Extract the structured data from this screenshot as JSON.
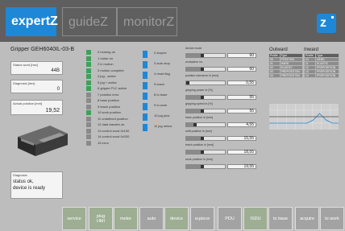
{
  "header": {
    "tabs": [
      {
        "label": "expertZ",
        "active": true
      },
      {
        "label": "guideZ",
        "active": false
      },
      {
        "label": "monitorZ",
        "active": false
      }
    ],
    "brand_glyph": "z",
    "accent_color": "#1e88d6"
  },
  "gripper": {
    "title": "Gripper GEH6040IL-03-B",
    "status_word": {
      "label": "Status word [hex]",
      "value": "44B"
    },
    "diagnosis": {
      "label": "Diagnosis [hex]",
      "value": "0"
    },
    "actual_position": {
      "label": "Actual position [mm]",
      "value": "19,52"
    },
    "diagnosis_panel": {
      "label": "Diagnosis",
      "text": "status ok,\ndevice is ready"
    }
  },
  "inputs": [
    {
      "num": "0",
      "label": "homing ok",
      "state": "green"
    },
    {
      "num": "1",
      "label": "motor on",
      "state": "green"
    },
    {
      "num": "2",
      "label": "in motion",
      "state": "green"
    },
    {
      "num": "3",
      "label": "motion complete",
      "state": "green"
    },
    {
      "num": "4",
      "label": "jog - active",
      "state": "green"
    },
    {
      "num": "5",
      "label": "jog + active",
      "state": "green"
    },
    {
      "num": "6",
      "label": "gripper PLC active",
      "state": "green"
    },
    {
      "num": "7",
      "label": "position error",
      "state": "gray"
    },
    {
      "num": "8",
      "label": "base position",
      "state": "gray"
    },
    {
      "num": "9",
      "label": "teach position",
      "state": "gray"
    },
    {
      "num": "10",
      "label": "work position",
      "state": "green"
    },
    {
      "num": "11",
      "label": "undefined position",
      "state": "gray"
    },
    {
      "num": "12",
      "label": "data transfer ok",
      "state": "gray"
    },
    {
      "num": "13",
      "label": "control word 0x100",
      "state": "gray"
    },
    {
      "num": "14",
      "label": "control word 0x200",
      "state": "gray"
    },
    {
      "num": "15",
      "label": "error",
      "state": "gray"
    }
  ],
  "outputs": [
    {
      "num": "0",
      "label": "stop/re"
    },
    {
      "num": "3",
      "label": "auto stop"
    },
    {
      "num": "4",
      "label": "reset flag"
    },
    {
      "num": "5",
      "label": "teach"
    },
    {
      "num": "8",
      "label": "to base"
    },
    {
      "num": "9",
      "label": "to work"
    },
    {
      "num": "10",
      "label": "jog plus"
    },
    {
      "num": "11",
      "label": "jog minus"
    }
  ],
  "params": [
    {
      "label": "device mode",
      "value": "60",
      "fill": 0.42
    },
    {
      "label": "workpiece no.",
      "value": "60",
      "fill": 0.42
    },
    {
      "label": "position tolerance in [mm]",
      "value": "0,55",
      "fill": 0.05
    },
    {
      "label": "gripping power in [%]",
      "value": "55",
      "fill": 0.42
    },
    {
      "label": "gripping speed in [%]",
      "value": "55",
      "fill": 0.42
    },
    {
      "label": "base position in [mm]",
      "value": "4,55",
      "fill": 0.22
    },
    {
      "label": "shift position in [mm]",
      "value": "15,55",
      "fill": 0.42
    },
    {
      "label": "teach position in [mm]",
      "value": "18,55",
      "fill": 0.42
    },
    {
      "label": "work position in [mm]",
      "value": "19,55",
      "fill": 0.42
    }
  ],
  "tables": {
    "outward": {
      "title": "Outward",
      "headers": [
        "Profile",
        "Type"
      ],
      "rows": [
        [
          "00",
          "POSITION"
        ],
        [
          "01",
          "HARD"
        ],
        [
          "02",
          "ELASTIC"
        ],
        [
          "03",
          "PREPOSITION"
        ],
        [
          "04",
          "PREPOSITION"
        ]
      ]
    },
    "inward": {
      "title": "Inward",
      "headers": [
        "Profile",
        "Type"
      ],
      "rows": [
        [
          "10",
          "HARD"
        ],
        [
          "11",
          "ELASTIC"
        ],
        [
          "12",
          "PREPOSITION"
        ],
        [
          "13",
          "PREPOSITION"
        ],
        [
          "14",
          "PREPOSITION"
        ]
      ]
    }
  },
  "chart_data": {
    "type": "line",
    "title": "",
    "xlabel": "",
    "ylabel": "",
    "grid": true,
    "series": [
      {
        "color": "#1e88d6",
        "values": [
          2,
          2,
          2,
          2,
          2,
          2,
          2,
          3,
          5,
          3,
          2,
          2
        ]
      },
      {
        "color": "#444444",
        "values": [
          4,
          4,
          4,
          4,
          4,
          4,
          4,
          4,
          4,
          4,
          4,
          4
        ]
      }
    ]
  },
  "footer": {
    "buttons": [
      {
        "label": "service",
        "color": "green"
      },
      {
        "label": "plug\nHMI",
        "color": "green"
      },
      {
        "label": "motor",
        "color": "green"
      },
      {
        "label": "auto",
        "color": "gray"
      },
      {
        "label": "device",
        "color": "green"
      },
      {
        "label": "w.piece",
        "color": "gray"
      },
      {
        "label": "PDU",
        "color": "gray"
      },
      {
        "label": "ISDU",
        "color": "green"
      },
      {
        "label": "to base",
        "color": "gray"
      },
      {
        "label": "acquire",
        "color": "gray"
      },
      {
        "label": "to work",
        "color": "gray"
      }
    ]
  }
}
